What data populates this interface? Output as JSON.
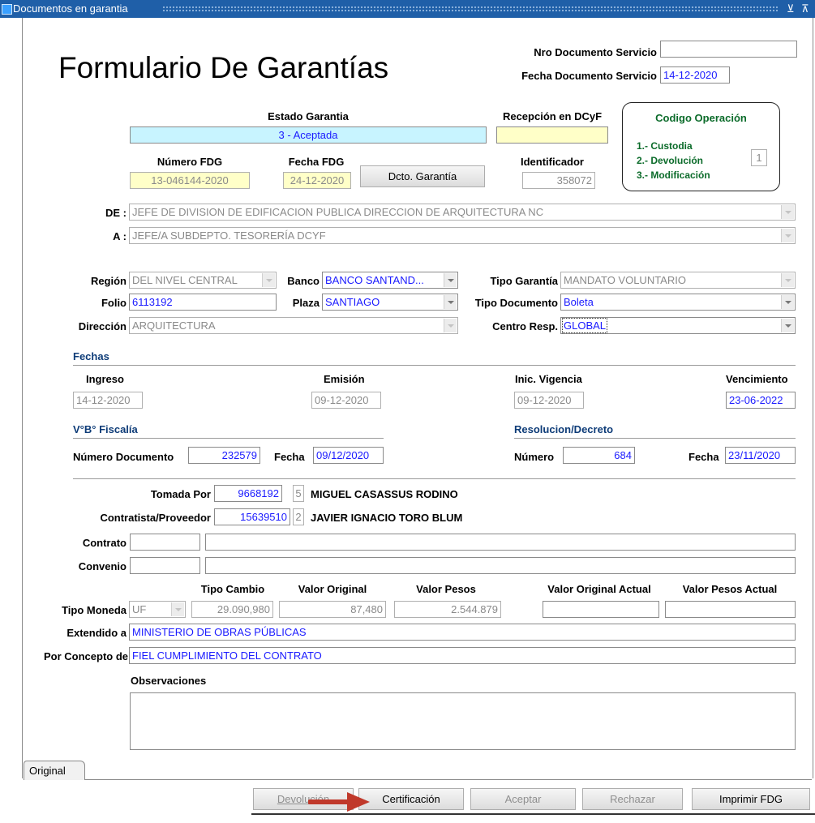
{
  "window": {
    "title": "Documentos en garantia",
    "minimize_glyph": "⊻",
    "restore_glyph": "⊼"
  },
  "form": {
    "title": "Formulario De Garantías",
    "nro_doc_servicio_label": "Nro Documento Servicio",
    "nro_doc_servicio_value": "",
    "fecha_doc_servicio_label": "Fecha Documento Servicio",
    "fecha_doc_servicio_value": "14-12-2020",
    "estado_label": "Estado Garantia",
    "estado_value": "3 - Aceptada",
    "recepcion_label": "Recepción en DCyF",
    "recepcion_value": "",
    "numero_fdg_label": "Número FDG",
    "numero_fdg_value": "13-046144-2020",
    "fecha_fdg_label": "Fecha FDG",
    "fecha_fdg_value": "24-12-2020",
    "dcto_garantia_button": "Dcto. Garantía",
    "identificador_label": "Identificador",
    "identificador_value": "358072"
  },
  "codigo_operacion": {
    "title": "Codigo Operación",
    "options": [
      "1.- Custodia",
      "2.- Devolución",
      "3.- Modificación"
    ],
    "value": "1"
  },
  "de": {
    "label": "DE :",
    "value": "JEFE DE DIVISION DE EDIFICACION PUBLICA DIRECCION DE ARQUITECTURA NC"
  },
  "a": {
    "label": "A :",
    "value": "JEFE/A SUBDEPTO. TESORERÍA DCYF"
  },
  "detalle": {
    "region_label": "Región",
    "region_value": "DEL NIVEL CENTRAL",
    "banco_label": "Banco",
    "banco_value": "BANCO SANTAND...",
    "tipo_garantia_label": "Tipo Garantía",
    "tipo_garantia_value": "MANDATO VOLUNTARIO",
    "folio_label": "Folio",
    "folio_value": "6113192",
    "plaza_label": "Plaza",
    "plaza_value": "SANTIAGO",
    "tipo_documento_label": "Tipo Documento",
    "tipo_documento_value": "Boleta",
    "direccion_label": "Dirección",
    "direccion_value": "ARQUITECTURA",
    "centro_resp_label": "Centro Resp.",
    "centro_resp_value": "GLOBAL"
  },
  "fechas": {
    "section": "Fechas",
    "ingreso_label": "Ingreso",
    "ingreso_value": "14-12-2020",
    "emision_label": "Emisión",
    "emision_value": "09-12-2020",
    "inic_label": "Inic. Vigencia",
    "inic_value": "09-12-2020",
    "venc_label": "Vencimiento",
    "venc_value": "23-06-2022"
  },
  "fiscalia": {
    "section": "V°B° Fiscalía",
    "numero_label": "Número Documento",
    "numero_value": "232579",
    "fecha_label": "Fecha",
    "fecha_value": "09/12/2020"
  },
  "resolucion": {
    "section": "Resolucion/Decreto",
    "numero_label": "Número",
    "numero_value": "684",
    "fecha_label": "Fecha",
    "fecha_value": "23/11/2020"
  },
  "personas": {
    "tomada_label": "Tomada Por",
    "tomada_rut": "9668192",
    "tomada_dv": "5",
    "tomada_nombre": "MIGUEL CASASSUS RODINO",
    "contratista_label": "Contratista/Proveedor",
    "contratista_rut": "15639510",
    "contratista_dv": "2",
    "contratista_nombre": "JAVIER IGNACIO TORO BLUM",
    "contrato_label": "Contrato",
    "convenio_label": "Convenio"
  },
  "moneda": {
    "tipo_cambio_header": "Tipo Cambio",
    "valor_original_header": "Valor Original",
    "valor_pesos_header": "Valor Pesos",
    "valor_original_actual_header": "Valor Original Actual",
    "valor_pesos_actual_header": "Valor Pesos Actual",
    "tipo_moneda_label": "Tipo Moneda",
    "tipo_moneda_value": "UF",
    "tipo_cambio_value": "29.090,980",
    "valor_original_value": "87,480",
    "valor_pesos_value": "2.544.879",
    "valor_original_actual_value": "",
    "valor_pesos_actual_value": ""
  },
  "extendido": {
    "label": "Extendido a",
    "value": "MINISTERIO DE OBRAS PÚBLICAS"
  },
  "concepto": {
    "label": "Por Concepto de",
    "value": "FIEL CUMPLIMIENTO DEL CONTRATO"
  },
  "observaciones": {
    "label": "Observaciones",
    "value": ""
  },
  "tabs": [
    {
      "label": "Original"
    }
  ],
  "buttons": {
    "devolucion": "Devolución",
    "certificacion": "Certificación",
    "aceptar": "Aceptar",
    "rechazar": "Rechazar",
    "imprimir": "Imprimir FDG"
  },
  "colors": {
    "title_bar": "#1f5fa8",
    "arrow": "#c0392b",
    "value_text": "#1a1aff",
    "cyan_field": "#c8f4ff",
    "yellow_field": "#ffffc8"
  }
}
